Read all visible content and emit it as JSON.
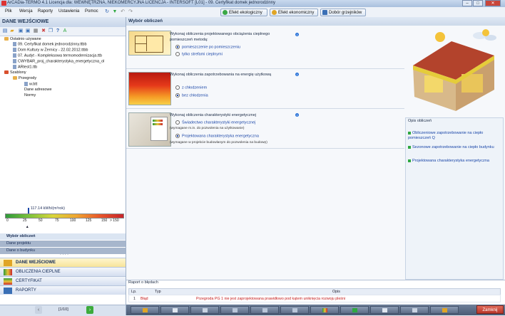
{
  "window": {
    "title": "ArCADia-TERMO 4.1 Licencja dla: WEWNĘTRZNA, NIEKOMERCYJNA LICENCJA - INTERSOFT [L01] - 09. Certyfikat domek jednorodzinny",
    "minimize": "–",
    "maximize": "□",
    "close": "✕"
  },
  "menu": {
    "items": [
      "Plik",
      "Wersja",
      "Raporty",
      "Ustawienia",
      "Pomoc"
    ],
    "top_buttons": [
      {
        "label": "Efekt ekologiczny",
        "color": "#3aa845"
      },
      {
        "label": "Efekt ekonomiczny",
        "color": "#e0a526"
      },
      {
        "label": "Dobór grzejników",
        "color": "#3a6fb5"
      }
    ]
  },
  "left": {
    "header": "DANE WEJŚCIOWE",
    "tree": {
      "recent_label": "Ostatnio używane",
      "recent_items": [
        "09. Certyfikat domek jednorodzinny.ttbb",
        "Dom Kultury w Żernicy - 22.02.2012.ttbb",
        "07. Audyt - Kompleksowa termomodernizacja.ttb",
        "CWYBAR_proj_charakterystyka_energetyczna_ol",
        "ARtest1.ttb"
      ],
      "templates_label": "Szablony",
      "templates_sub": "Przegrody",
      "templates_file": "w.btt",
      "addresses": "Dane adresowe",
      "norms": "Normy"
    },
    "scale": {
      "value": "117.14 kWh/(m²rok)",
      "ticks": [
        "0",
        "25",
        "50",
        "75",
        "100",
        "125",
        "150",
        "> 150"
      ],
      "value_fraction": 0.19
    },
    "nav_sub": [
      "Wybór obliczeń",
      "Dane projektu",
      "Dane o budynku"
    ],
    "nav_sub_more": "· · · ·",
    "nav_main": [
      "DANE WEJŚCIOWE",
      "OBLICZENIA CIEPLNE",
      "CERTYFIKAT",
      "RAPORTY"
    ],
    "pager": {
      "prev": "‹",
      "next": "›",
      "text": "[1/10]"
    }
  },
  "main": {
    "header": "Wybór obliczeń",
    "section1": {
      "title_line1": "Wykonaj obliczenia projektowanego obciążenia cieplnego",
      "title_line2": "pomieszczeń metodą:",
      "options": [
        "pomieszczenie po pomieszczeniu",
        "tylko strefami cieplnymi"
      ],
      "selected": 0
    },
    "section2": {
      "title": "Wykonaj obliczenia zapotrzebowania na energię użytkową",
      "options": [
        "z chłodzeniem",
        "bez chłodzenia"
      ],
      "selected": 1
    },
    "section3": {
      "title": "Wykonaj obliczenia charakterystyki energetycznej",
      "option1": "Świadectwo charakterystyki energetycznej",
      "note1": "(wymagane m.in. do pozwolenia na użytkowanie)",
      "option2": "Projektowana charakterystyka energetyczna",
      "note2": "(wymagane w projekcie budowlanym do pozwolenia na budowę)",
      "selected": 1
    },
    "info_glyph": "i"
  },
  "opis": {
    "title": "Opis obliczeń",
    "items": [
      "Obliczeniowe zapotrzebowanie na ciepło pomieszczeń Q",
      "Sezonowe zapotrzebowanie na ciepło budynku",
      "Projektowana charakterystyka energetyczna"
    ]
  },
  "raport": {
    "title": "Raport o błędach",
    "columns": [
      "Lp.",
      "Typ",
      "Opis"
    ],
    "rows": [
      {
        "lp": "1",
        "typ": "Błąd",
        "opis": "Przegroda PG 1 nie jest zaprojektowana prawidłowo pod kątem uniknięcia rozwoju pleśni"
      }
    ]
  },
  "bottom": {
    "close_label": "Zamknij"
  },
  "colors": {
    "accent_blue": "#1a46a8",
    "error_red": "#c41a1a",
    "ok_green": "#2fa840"
  }
}
